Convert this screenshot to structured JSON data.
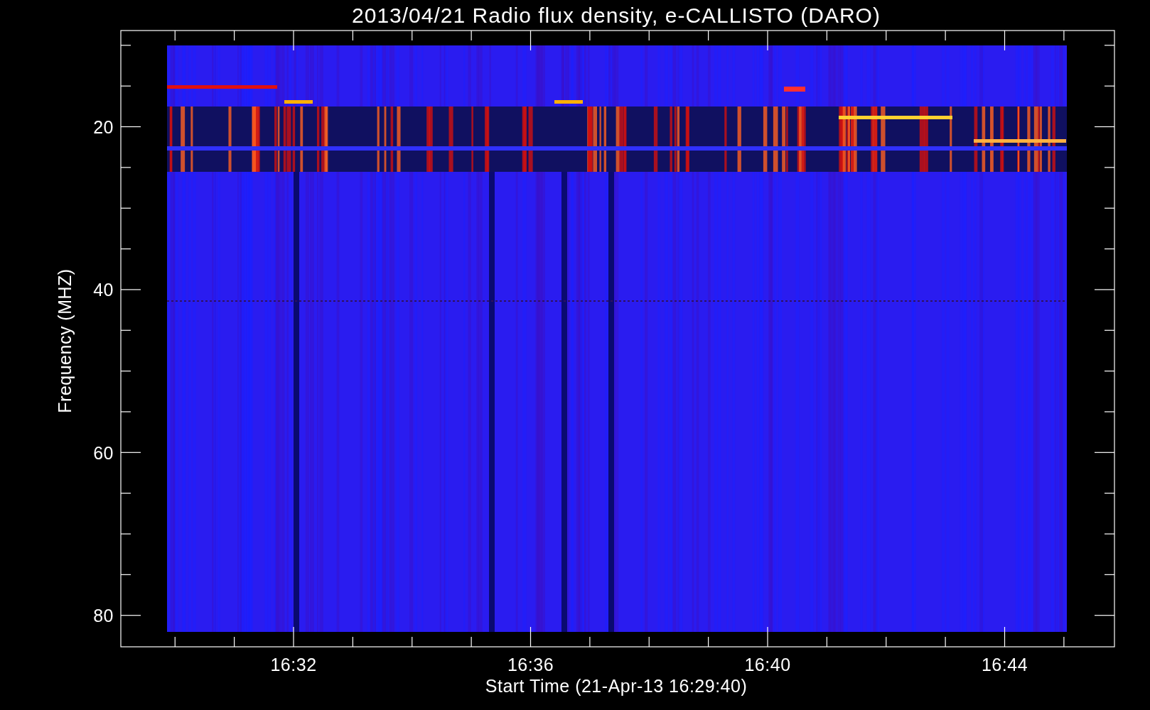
{
  "chart": {
    "title": "2013/04/21  Radio flux density, e-CALLISTO (DARO)",
    "ylabel": "Frequency (MHZ)",
    "xlabel": "Start Time (21-Apr-13 16:29:40)",
    "yticks": [
      "20",
      "40",
      "60",
      "80"
    ],
    "xticks": [
      "16:32",
      "16:36",
      "16:40",
      "16:44"
    ]
  }
}
